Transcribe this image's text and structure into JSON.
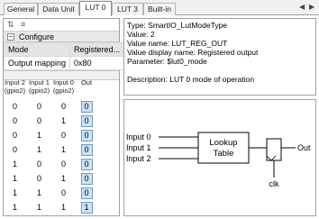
{
  "tabs": [
    "General",
    "Data Unit",
    "LUT 0",
    "LUT 3",
    "Built-in"
  ],
  "active_tab": "LUT 0",
  "config": {
    "section_label": "Configure",
    "columns": [
      "Mode",
      "Registered..."
    ],
    "rows": [
      [
        "Output mapping",
        "0x80"
      ]
    ]
  },
  "truth_table": {
    "headers": [
      "Input 2 (gpio2)",
      "Input 1 (gpio2)",
      "Input 0 (gpio2)",
      "Out"
    ],
    "rows": [
      [
        "0",
        "0",
        "0",
        "0"
      ],
      [
        "0",
        "0",
        "1",
        "0"
      ],
      [
        "0",
        "1",
        "0",
        "0"
      ],
      [
        "0",
        "1",
        "1",
        "0"
      ],
      [
        "1",
        "0",
        "0",
        "0"
      ],
      [
        "1",
        "0",
        "1",
        "0"
      ],
      [
        "1",
        "1",
        "0",
        "0"
      ],
      [
        "1",
        "1",
        "1",
        "1"
      ]
    ]
  },
  "info": {
    "type": "Type: SmartIO_LutModeType",
    "value": "Value: 2",
    "value_name": "Value name: LUT_REG_OUT",
    "value_display": "Value display name: Registered output",
    "parameter": "Parameter: $lut0_mode",
    "description": "Description: LUT 0 mode of operation"
  },
  "diagram": {
    "inputs": [
      "Input 0",
      "Input 1",
      "Input 2"
    ],
    "block_line1": "Lookup",
    "block_line2": "Table",
    "output": "Out",
    "clock": "clk"
  },
  "colors": {
    "out_cell": "#cde2f5",
    "out_border": "#6f9bc5"
  },
  "icons": {
    "sort": "sort-icon",
    "filter": "filter-icon",
    "collapse": "collapse-icon"
  }
}
